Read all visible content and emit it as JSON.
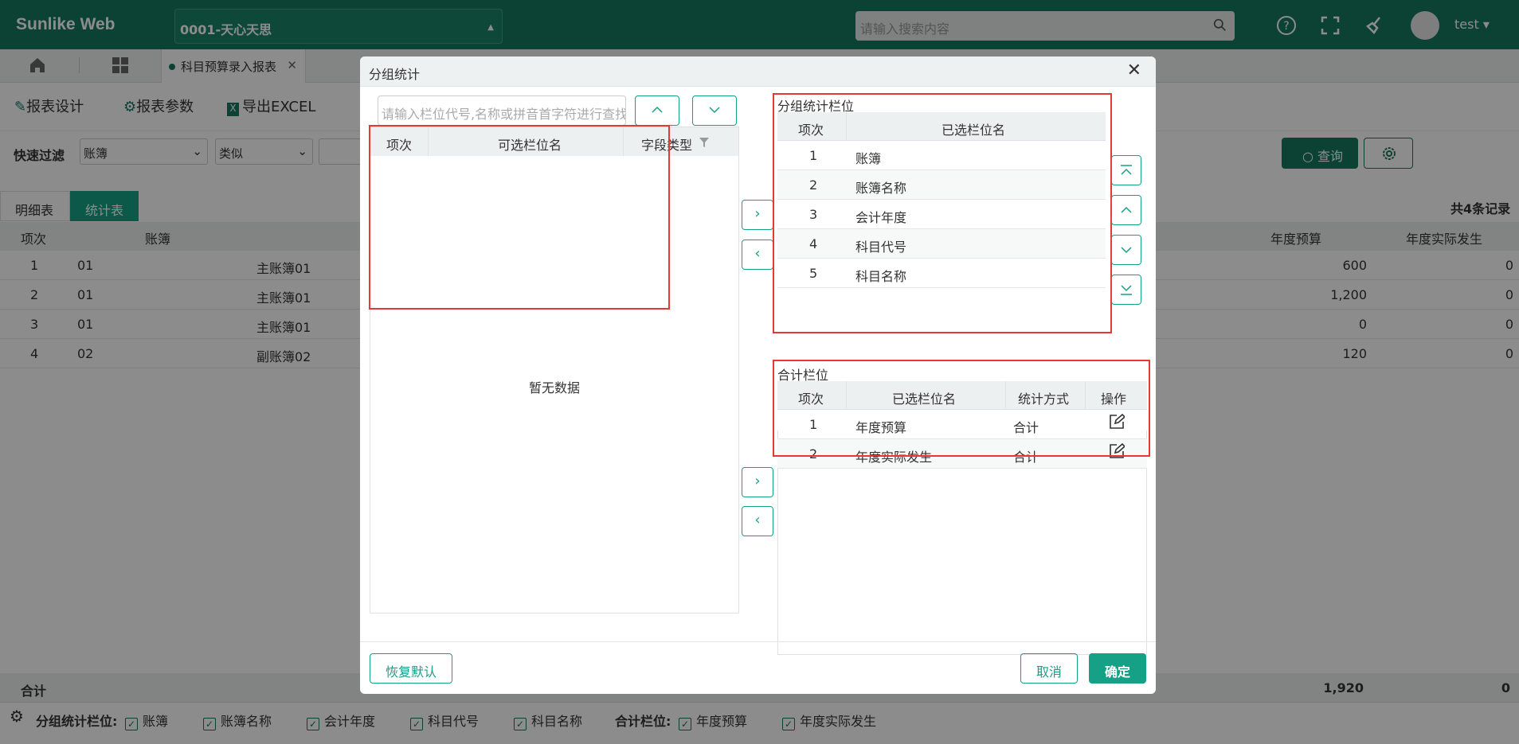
{
  "app": {
    "brand": "Sunlike Web",
    "company": "0001-天心天思",
    "search_placeholder": "请输入搜索内容",
    "user": "test"
  },
  "tabs": {
    "active_tab": "科目预算录入报表"
  },
  "toolbar": {
    "design": "报表设计",
    "params": "报表参数",
    "export": "导出EXCEL"
  },
  "filter": {
    "label": "快速过滤",
    "field": "账簿",
    "op": "类似",
    "query": "查询"
  },
  "view_tabs": {
    "detail": "明细表",
    "stats": "统计表",
    "count": "共4条记录"
  },
  "table": {
    "headers": {
      "no": "项次",
      "book": "账簿",
      "budget": "年度预算",
      "actual": "年度实际发生"
    },
    "rows": [
      {
        "no": "1",
        "book": "01",
        "name": "主账簿01",
        "budget": "600",
        "actual": "0"
      },
      {
        "no": "2",
        "book": "01",
        "name": "主账簿01",
        "budget": "1,200",
        "actual": "0"
      },
      {
        "no": "3",
        "book": "01",
        "name": "主账簿01",
        "budget": "0",
        "actual": "0"
      },
      {
        "no": "4",
        "book": "02",
        "name": "副账簿02",
        "budget": "120",
        "actual": "0"
      }
    ],
    "sum_label": "合计",
    "sum_budget": "1,920",
    "sum_actual": "0"
  },
  "bottom": {
    "group_label": "分组统计栏位:",
    "group_items": [
      "账簿",
      "账簿名称",
      "会计年度",
      "科目代号",
      "科目名称"
    ],
    "sum_label": "合计栏位:",
    "sum_items": [
      "年度预算",
      "年度实际发生"
    ]
  },
  "dialog": {
    "title": "分组统计",
    "search_placeholder": "请输入栏位代号,名称或拼音首字符进行查找",
    "left_headers": {
      "no": "项次",
      "name": "可选栏位名",
      "type": "字段类型"
    },
    "no_data": "暂无数据",
    "group_section": "分组统计栏位",
    "group_headers": {
      "no": "项次",
      "name": "已选栏位名"
    },
    "group_rows": [
      {
        "no": "1",
        "name": "账簿"
      },
      {
        "no": "2",
        "name": "账簿名称"
      },
      {
        "no": "3",
        "name": "会计年度"
      },
      {
        "no": "4",
        "name": "科目代号"
      },
      {
        "no": "5",
        "name": "科目名称"
      }
    ],
    "sum_section": "合计栏位",
    "sum_headers": {
      "no": "项次",
      "name": "已选栏位名",
      "method": "统计方式",
      "op": "操作"
    },
    "sum_rows": [
      {
        "no": "1",
        "name": "年度预算",
        "method": "合计"
      },
      {
        "no": "2",
        "name": "年度实际发生",
        "method": "合计"
      }
    ],
    "reset": "恢复默认",
    "cancel": "取消",
    "ok": "确定"
  },
  "colors": {
    "primary": "#16795e",
    "accent": "#16a085",
    "highlight": "#e53935"
  }
}
